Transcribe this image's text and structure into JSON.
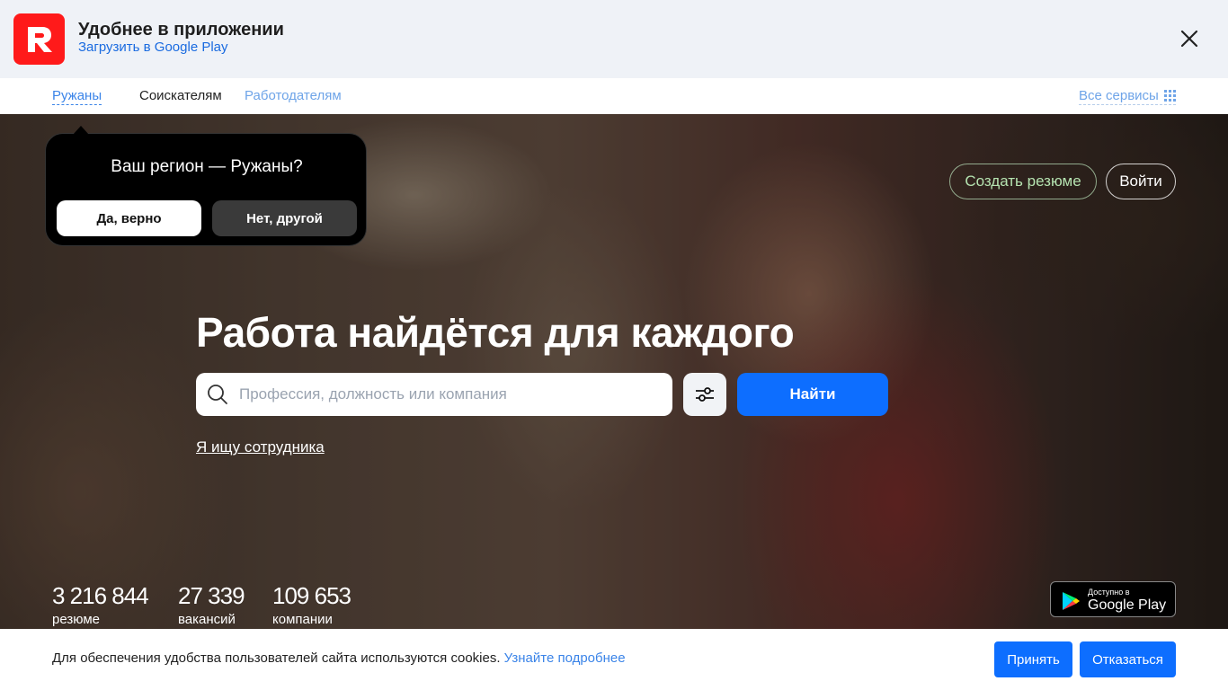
{
  "app_banner": {
    "title": "Удобнее в приложении",
    "link": "Загрузить в Google Play",
    "logo_letter": "R",
    "brand_color": "#ff1a1a"
  },
  "nav": {
    "region": "Ружаны",
    "seekers": "Соискателям",
    "employers": "Работодателям",
    "services": "Все сервисы"
  },
  "region_popup": {
    "question": "Ваш регион — Ружаны?",
    "yes": "Да, верно",
    "no": "Нет, другой"
  },
  "header_actions": {
    "create_resume": "Создать резюме",
    "login": "Войти"
  },
  "hero": {
    "title": "Работа найдётся для каждого",
    "search_placeholder": "Профессия, должность или компания",
    "find": "Найти",
    "employer_link": "Я ищу сотрудника"
  },
  "stats": [
    {
      "value": "3 216 844",
      "label": "резюме"
    },
    {
      "value": "27 339",
      "label": "вакансий"
    },
    {
      "value": "109 653",
      "label": "компании"
    }
  ],
  "store_badge": {
    "small": "Доступно в",
    "big": "Google Play"
  },
  "cookie": {
    "text": "Для обеспечения удобства пользователей сайта используются cookies.",
    "link": "Узнайте подробнее",
    "accept": "Принять",
    "decline": "Отказаться"
  },
  "colors": {
    "accent": "#0d6eff",
    "link": "#3b84e8"
  }
}
